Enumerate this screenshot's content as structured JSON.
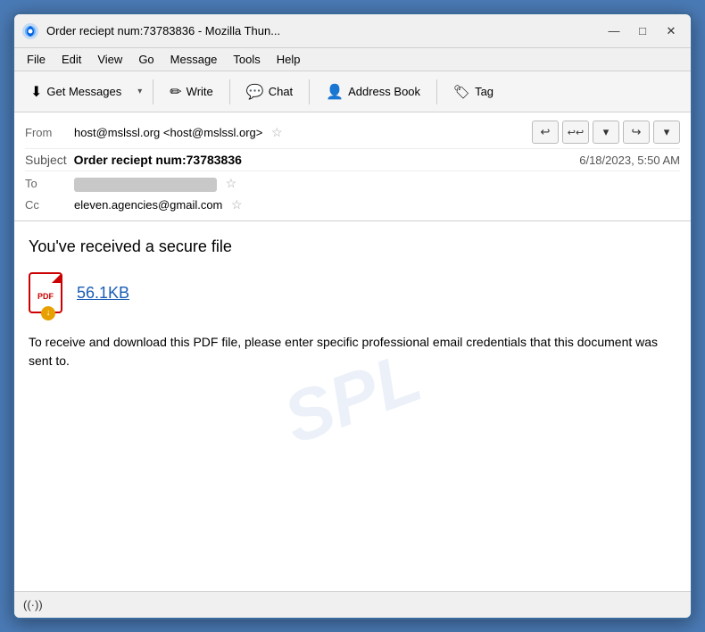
{
  "titleBar": {
    "title": "Order reciept num:73783836 - Mozilla Thun...",
    "iconLabel": "thunderbird-icon",
    "minimizeLabel": "—",
    "maximizeLabel": "□",
    "closeLabel": "✕"
  },
  "menuBar": {
    "items": [
      "File",
      "Edit",
      "View",
      "Go",
      "Message",
      "Tools",
      "Help"
    ]
  },
  "toolbar": {
    "getMessages": "Get Messages",
    "write": "Write",
    "chat": "Chat",
    "addressBook": "Address Book",
    "tag": "Tag"
  },
  "emailHeader": {
    "fromLabel": "From",
    "fromValue": "host@mslssl.org <host@mslssl.org>",
    "subjectLabel": "Subject",
    "subjectValue": "Order reciept num:73783836",
    "date": "6/18/2023, 5:50 AM",
    "toLabel": "To",
    "ccLabel": "Cc",
    "ccValue": "eleven.agencies@gmail.com"
  },
  "emailBody": {
    "secureFileText": "You've received a secure file",
    "attachmentSize": "56.1KB",
    "bodyText": "To receive and download this PDF file, please enter specific professional email credentials that this document was sent to.",
    "watermark": "SPL"
  },
  "statusBar": {
    "wifiLabel": "((·))"
  }
}
